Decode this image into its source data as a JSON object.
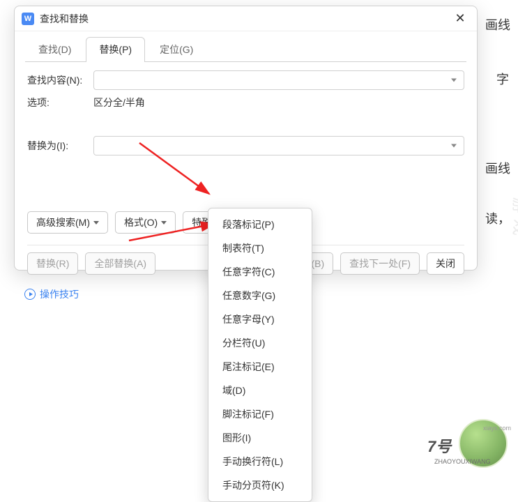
{
  "background": {
    "text1": "画线",
    "text2": "字",
    "text3": "画线",
    "text4": "读，"
  },
  "dialog": {
    "title": "查找和替换",
    "tabs": {
      "find": "查找(D)",
      "replace": "替换(P)",
      "goto": "定位(G)"
    },
    "form": {
      "find_label": "查找内容(N):",
      "options_label": "选项:",
      "options_value": "区分全/半角",
      "replace_label": "替换为(I):"
    },
    "buttons": {
      "advanced": "高级搜索(M)",
      "format": "格式(O)",
      "special": "特殊格式(E)",
      "replace": "替换(R)",
      "replace_all": "全部替换(A)",
      "find_prev_suffix": "(B)",
      "find_next": "查找下一处(F)",
      "close": "关闭"
    },
    "footer_link": "操作技巧"
  },
  "menu": {
    "items": [
      "段落标记(P)",
      "制表符(T)",
      "任意字符(C)",
      "任意数字(G)",
      "任意字母(Y)",
      "分栏符(U)",
      "尾注标记(E)",
      "域(D)",
      "脚注标记(F)",
      "图形(I)",
      "手动换行符(L)",
      "手动分页符(K)"
    ]
  },
  "watermark": {
    "main": "7号",
    "sub": "ZHAOYOUXIWANG",
    "url": "xiayx.com",
    "side": "游戏"
  }
}
